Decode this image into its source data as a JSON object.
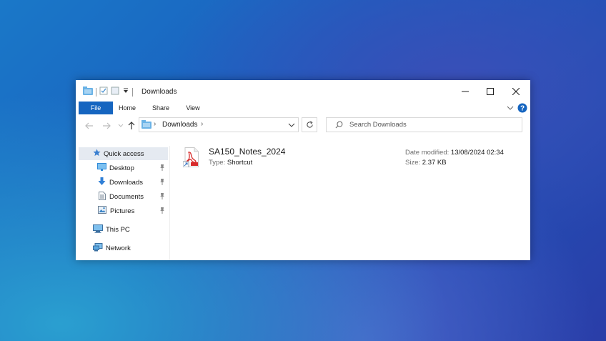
{
  "window": {
    "title": "Downloads"
  },
  "ribbon": {
    "tabs": [
      "File",
      "Home",
      "Share",
      "View"
    ]
  },
  "address": {
    "crumb": "Downloads"
  },
  "search": {
    "placeholder": "Search Downloads"
  },
  "sidebar": {
    "items": [
      {
        "label": "Quick access",
        "icon": "star-icon",
        "selected": true
      },
      {
        "label": "Desktop",
        "icon": "desktop-folder-icon",
        "pinned": true
      },
      {
        "label": "Downloads",
        "icon": "download-arrow-icon",
        "pinned": true
      },
      {
        "label": "Documents",
        "icon": "documents-icon",
        "pinned": true
      },
      {
        "label": "Pictures",
        "icon": "pictures-icon",
        "pinned": true
      },
      {
        "label": "This PC",
        "icon": "computer-icon"
      },
      {
        "label": "Network",
        "icon": "network-icon"
      }
    ]
  },
  "file": {
    "name": "SA150_Notes_2024",
    "type_label": "Type:",
    "type_value": "Shortcut",
    "date_label": "Date modified:",
    "date_value": "13/08/2024 02:34",
    "size_label": "Size:",
    "size_value": "2.37 KB",
    "icon": "pdf-shortcut-icon"
  },
  "colors": {
    "accent": "#1565c0",
    "selected_bg": "#e5eaf1"
  }
}
